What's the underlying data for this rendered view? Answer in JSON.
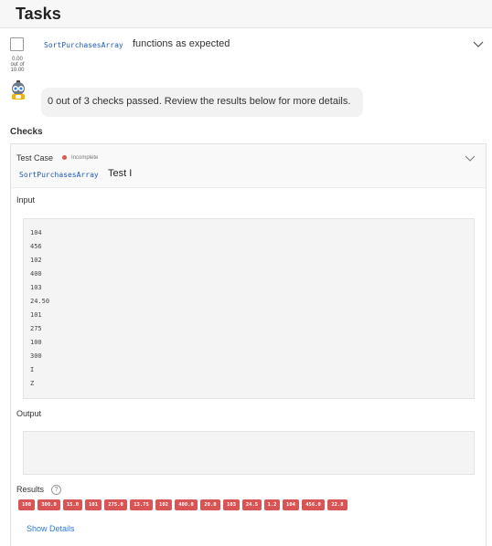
{
  "header": {
    "title": "Tasks"
  },
  "task": {
    "score_lines": [
      "0.00",
      "out of",
      "10.00"
    ],
    "function_name": "SortPurchasesArray",
    "description": "functions as expected"
  },
  "bot_message": "0 out of 3 checks passed. Review the results below for more details.",
  "checks_label": "Checks",
  "test_case": {
    "label": "Test Case",
    "status": "Incomplete",
    "function_name": "SortPurchasesArray",
    "test_name": "Test I"
  },
  "input_label": "Input",
  "input_lines": [
    "104",
    "456",
    "102",
    "400",
    "103",
    "24.50",
    "101",
    "275",
    "100",
    "300",
    "I",
    "Z"
  ],
  "output_label": "Output",
  "results_label": "Results",
  "help_icon_glyph": "?",
  "result_badges": [
    "100",
    "300.0",
    "15.0",
    "101",
    "275.0",
    "13.75",
    "102",
    "400.0",
    "20.0",
    "103",
    "24.5",
    "1.2",
    "104",
    "456.0",
    "22.8"
  ],
  "show_details": "Show Details",
  "colors": {
    "link": "#2c7bd8",
    "code_name": "#1e5bb8",
    "fail_badge": "#d95555",
    "status_dot": "#e05757"
  }
}
